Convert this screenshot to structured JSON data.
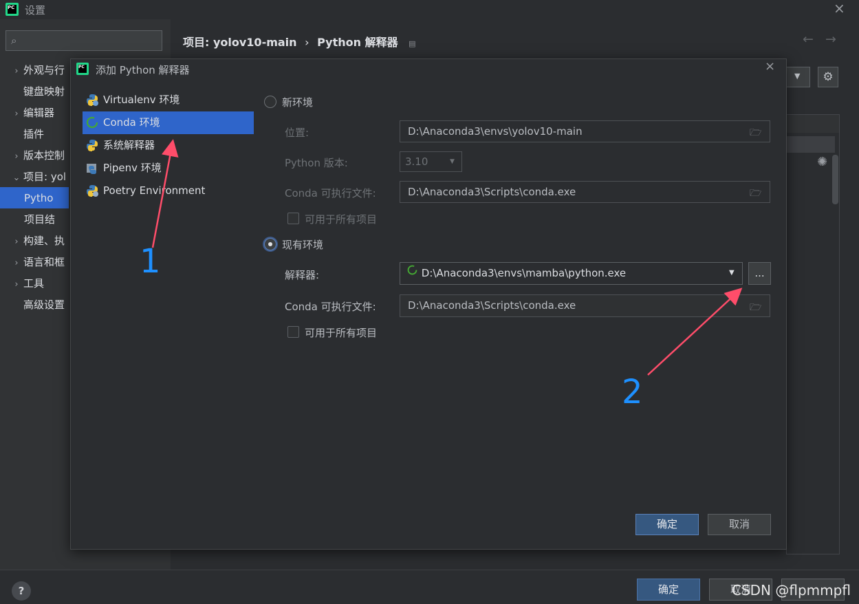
{
  "window": {
    "title": "设置",
    "close": "×",
    "logo_text": "PC"
  },
  "sidebar": {
    "search_placeholder": "",
    "items": [
      {
        "chev": "›",
        "label": "外观与行"
      },
      {
        "chev": "",
        "label": "键盘映射"
      },
      {
        "chev": "›",
        "label": "编辑器"
      },
      {
        "chev": "",
        "label": "插件"
      },
      {
        "chev": "›",
        "label": "版本控制"
      },
      {
        "chev": "⌄",
        "label": "项目: yol"
      },
      {
        "chev": "",
        "label": "Pytho"
      },
      {
        "chev": "",
        "label": "项目结"
      },
      {
        "chev": "›",
        "label": "构建、执"
      },
      {
        "chev": "›",
        "label": "语言和框"
      },
      {
        "chev": "›",
        "label": "工具"
      },
      {
        "chev": "",
        "label": "高级设置"
      }
    ]
  },
  "header": {
    "breadcrumb_project": "项目: yolov10-main",
    "breadcrumb_sep": "›",
    "breadcrumb_page": "Python 解释器",
    "back": "←",
    "forward": "→"
  },
  "dialog": {
    "title": "添加 Python 解释器",
    "logo_text": "PC",
    "close": "×",
    "env_types": [
      "Virtualenv 环境",
      "Conda 环境",
      "系统解释器",
      "Pipenv 环境",
      "Poetry Environment"
    ],
    "selected_env_type": "Conda 环境",
    "new_env": {
      "radio_label": "新环境",
      "location_label": "位置:",
      "location_value": "D:\\Anaconda3\\envs\\yolov10-main",
      "python_version_label": "Python 版本:",
      "python_version_value": "3.10",
      "conda_exec_label": "Conda 可执行文件:",
      "conda_exec_value": "D:\\Anaconda3\\Scripts\\conda.exe",
      "all_projects_label": "可用于所有项目"
    },
    "existing_env": {
      "radio_label": "现有环境",
      "selected": true,
      "interpreter_label": "解释器:",
      "interpreter_value": "D:\\Anaconda3\\envs\\mamba\\python.exe",
      "browse_label": "...",
      "conda_exec_label": "Conda 可执行文件:",
      "conda_exec_value": "D:\\Anaconda3\\Scripts\\conda.exe",
      "all_projects_label": "可用于所有项目"
    },
    "ok_label": "确定",
    "cancel_label": "取消"
  },
  "footer": {
    "help": "?",
    "ok_label": "确定",
    "cancel_label": "取消"
  },
  "annotations": {
    "one": "1",
    "two": "2"
  },
  "watermark": "CSDN @flpmmpfl",
  "colors": {
    "selection": "#2f65ca",
    "annotation_arrow": "#ff4d6a",
    "annotation_number": "#1e90ff"
  }
}
